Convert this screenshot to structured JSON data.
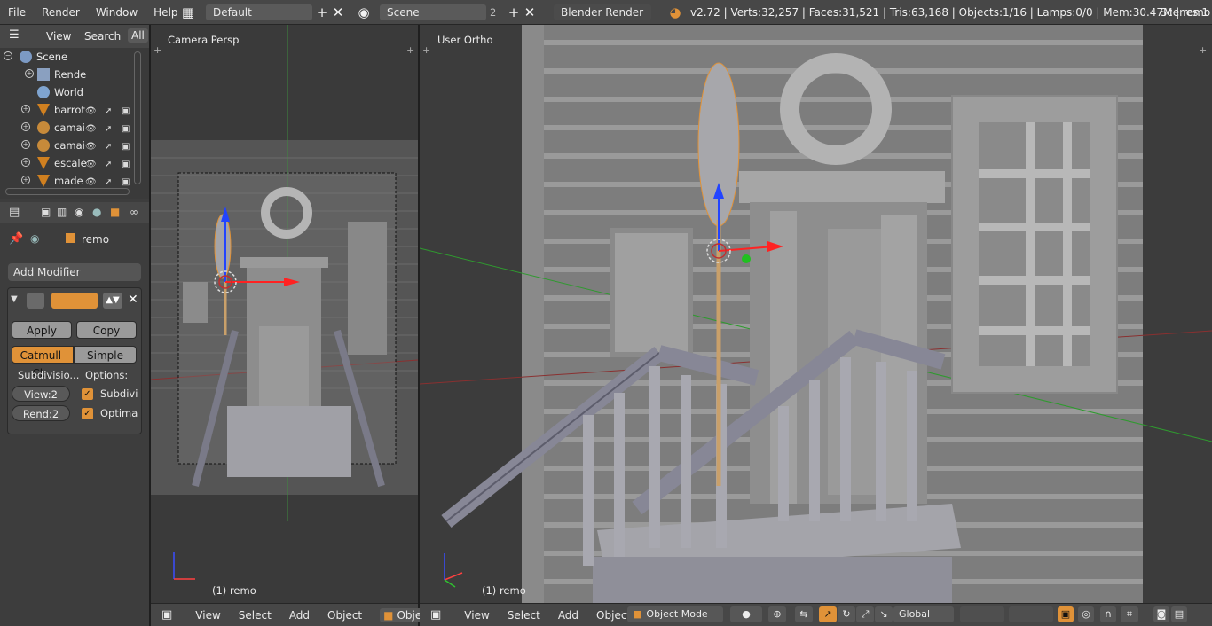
{
  "topbar": {
    "menu": [
      "File",
      "Render",
      "Window",
      "Help"
    ],
    "layout": "Default",
    "scene": "Scene",
    "scene_users": "2",
    "engine": "Blender Render",
    "stats": "v2.72 | Verts:32,257 | Faces:31,521 | Tris:63,168 | Objects:1/16 | Lamps:0/0 | Mem:30.47M | remo",
    "scenes_label": "Scenes:1"
  },
  "outliner": {
    "header": [
      "View",
      "Search",
      "All"
    ],
    "items": [
      {
        "label": "Scene",
        "icon": "scene-icon"
      },
      {
        "label": "Rende",
        "icon": "render-layers-icon"
      },
      {
        "label": "World",
        "icon": "world-icon"
      },
      {
        "label": "barrot",
        "icon": "mesh-icon"
      },
      {
        "label": "camai",
        "icon": "camera-object-icon"
      },
      {
        "label": "camai",
        "icon": "camera-object-icon"
      },
      {
        "label": "escale",
        "icon": "mesh-icon"
      },
      {
        "label": "made",
        "icon": "mesh-icon"
      }
    ]
  },
  "properties": {
    "object_name": "remo",
    "add_modifier": "Add Modifier",
    "apply": "Apply",
    "copy": "Copy",
    "catmull": "Catmull-Cl...",
    "simple": "Simple",
    "subdivisions_label": "Subdivisio...",
    "options_label": "Options:",
    "view_value": "View:2",
    "render_value": "Rend:2",
    "opt1": "Subdivi",
    "opt2": "Optima"
  },
  "viewport_left": {
    "label": "Camera Persp",
    "object_label": "(1) remo",
    "menu": [
      "View",
      "Select",
      "Add",
      "Object",
      "Object Mo"
    ]
  },
  "viewport_right": {
    "label": "User Ortho",
    "object_label": "(1) remo",
    "menu": [
      "View",
      "Select",
      "Add",
      "Object"
    ],
    "mode": "Object Mode",
    "orientation": "Global"
  },
  "colors": {
    "accent": "#e09238",
    "header": "#474747",
    "panel": "#3d3d3d",
    "viewport_bg": "#3c3c3c",
    "mesh": "#a3a3a9"
  }
}
